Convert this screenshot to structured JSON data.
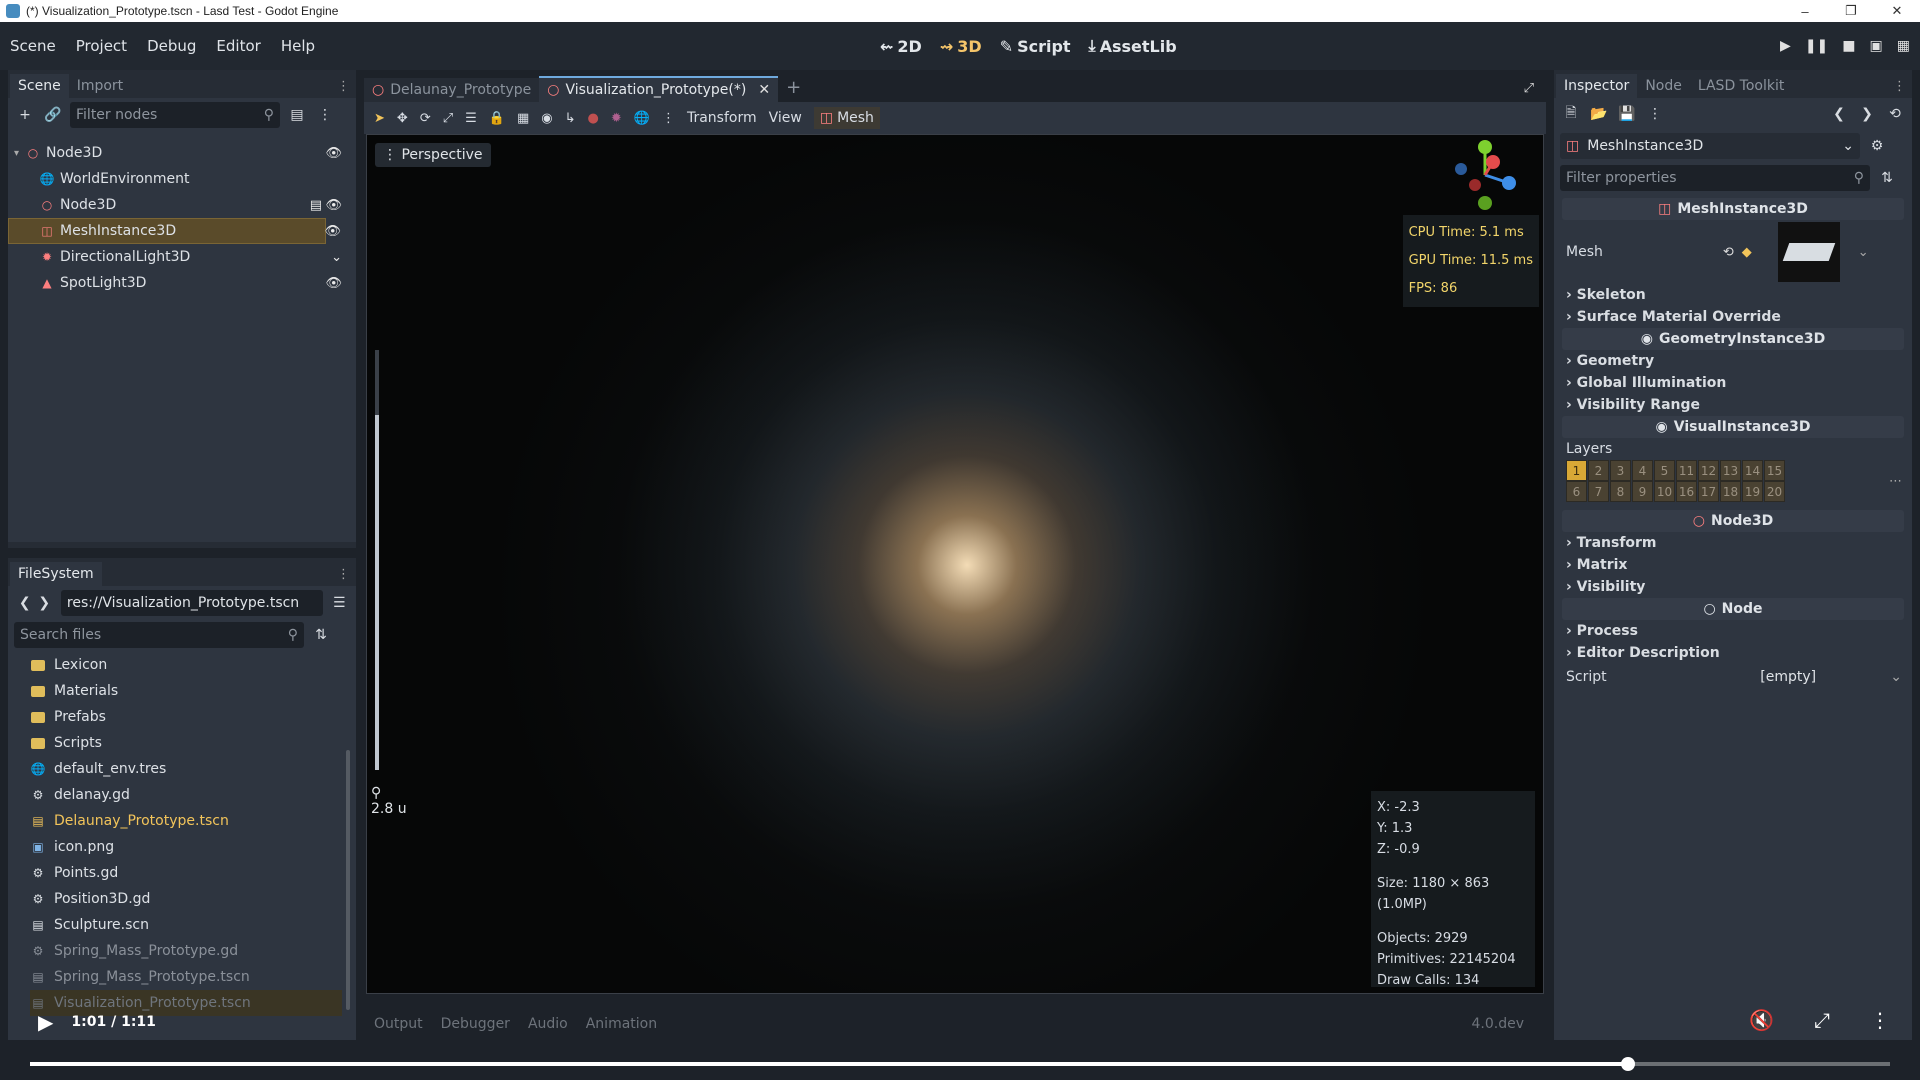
{
  "window": {
    "title": "(*) Visualization_Prototype.tscn - Lasd Test - Godot Engine",
    "controls": [
      "minimize",
      "restore",
      "close"
    ]
  },
  "menubar": {
    "items": [
      "Scene",
      "Project",
      "Debug",
      "Editor",
      "Help"
    ],
    "modes": [
      {
        "label": "2D",
        "icon": "2d-icon",
        "active": false
      },
      {
        "label": "3D",
        "icon": "3d-icon",
        "active": true
      },
      {
        "label": "Script",
        "icon": "script-icon",
        "active": false
      },
      {
        "label": "AssetLib",
        "icon": "assetlib-icon",
        "active": false
      }
    ],
    "run_buttons": [
      "play-icon",
      "pause-icon",
      "stop-icon",
      "play-scene-icon",
      "play-custom-scene-icon"
    ]
  },
  "scene_dock": {
    "tabs": [
      "Scene",
      "Import"
    ],
    "filter_placeholder": "Filter nodes",
    "nodes": [
      {
        "label": "Node3D",
        "icon": "node3d-icon",
        "depth": 0,
        "expanded": true,
        "eye": true,
        "selected": false,
        "color": "#fc7f7f"
      },
      {
        "label": "WorldEnvironment",
        "icon": "world-environment-icon",
        "depth": 1,
        "eye": false,
        "selected": false,
        "color": "#fc7f7f"
      },
      {
        "label": "Node3D",
        "icon": "node3d-icon",
        "depth": 1,
        "eye": true,
        "selected": false,
        "color": "#fc7f7f",
        "extra": "instance-icon"
      },
      {
        "label": "MeshInstance3D",
        "icon": "mesh-instance-icon",
        "depth": 1,
        "eye": true,
        "selected": true,
        "color": "#fc7f7f"
      },
      {
        "label": "DirectionalLight3D",
        "icon": "directional-light-icon",
        "depth": 1,
        "eye": false,
        "selected": false,
        "color": "#fc7f7f",
        "extra": "chevron-down-icon"
      },
      {
        "label": "SpotLight3D",
        "icon": "spotlight-icon",
        "depth": 1,
        "eye": true,
        "selected": false,
        "color": "#fc7f7f"
      }
    ]
  },
  "filesystem": {
    "tab": "FileSystem",
    "path": "res://Visualization_Prototype.tscn",
    "search_placeholder": "Search files",
    "items": [
      {
        "label": "Lexicon",
        "type": "folder"
      },
      {
        "label": "Materials",
        "type": "folder"
      },
      {
        "label": "Prefabs",
        "type": "folder"
      },
      {
        "label": "Scripts",
        "type": "folder"
      },
      {
        "label": "default_env.tres",
        "type": "resource"
      },
      {
        "label": "delanay.gd",
        "type": "script"
      },
      {
        "label": "Delaunay_Prototype.tscn",
        "type": "scene",
        "highlight": true
      },
      {
        "label": "icon.png",
        "type": "image"
      },
      {
        "label": "Points.gd",
        "type": "script"
      },
      {
        "label": "Position3D.gd",
        "type": "script"
      },
      {
        "label": "Sculpture.scn",
        "type": "scene"
      },
      {
        "label": "Spring_Mass_Prototype.gd",
        "type": "script",
        "dim": true
      },
      {
        "label": "Spring_Mass_Prototype.tscn",
        "type": "scene",
        "dim": true
      },
      {
        "label": "Visualization_Prototype.tscn",
        "type": "scene",
        "dim": true
      }
    ]
  },
  "editor_tabs": {
    "tabs": [
      {
        "label": "Delaunay_Prototype",
        "active": false
      },
      {
        "label": "Visualization_Prototype(*)",
        "active": true
      }
    ],
    "toolbar_menus": [
      "Transform",
      "View"
    ],
    "mesh_menu": "Mesh"
  },
  "viewport": {
    "perspective_label": "Perspective",
    "cpu_time": "CPU Time: 5.1 ms",
    "gpu_time": "GPU Time: 11.5 ms",
    "fps": "FPS: 86",
    "zoom_label": "2.8 u",
    "coord_x": "X: -2.3",
    "coord_y": "Y: 1.3",
    "coord_z": "Z: -0.9",
    "size": "Size: 1180 × 863 (1.0MP)",
    "objects": "Objects: 2929",
    "primitives": "Primitives: 22145204",
    "draw_calls": "Draw Calls: 134",
    "gizmo": {
      "x_color": "#e34c4c",
      "y_color": "#7ed12f",
      "z_color": "#3e8ee8"
    }
  },
  "bottom_panel": {
    "tabs": [
      "Output",
      "Debugger",
      "Audio",
      "Animation"
    ],
    "version": "4.0.dev"
  },
  "inspector": {
    "tabs": [
      "Inspector",
      "Node",
      "LASD Toolkit"
    ],
    "object_name": "MeshInstance3D",
    "filter_placeholder": "Filter properties",
    "class_header": "MeshInstance3D",
    "mesh_label": "Mesh",
    "sections_mesh": [
      "Skeleton",
      "Surface Material Override"
    ],
    "geometry_header": "GeometryInstance3D",
    "sections_geometry": [
      "Geometry",
      "Global Illumination",
      "Visibility Range"
    ],
    "visual_header": "VisualInstance3D",
    "layers_label": "Layers",
    "layers_row1": [
      "1",
      "2",
      "3",
      "4",
      "5",
      "11",
      "12",
      "13",
      "14",
      "15"
    ],
    "layers_row2": [
      "6",
      "7",
      "8",
      "9",
      "10",
      "16",
      "17",
      "18",
      "19",
      "20"
    ],
    "node3d_header": "Node3D",
    "sections_node3d": [
      "Transform",
      "Matrix",
      "Visibility"
    ],
    "node_header": "Node",
    "sections_node": [
      "Process",
      "Editor Description"
    ],
    "script_label": "Script",
    "script_value": "[empty]"
  },
  "video": {
    "time": "1:01 / 1:11",
    "progress": 0.859
  }
}
